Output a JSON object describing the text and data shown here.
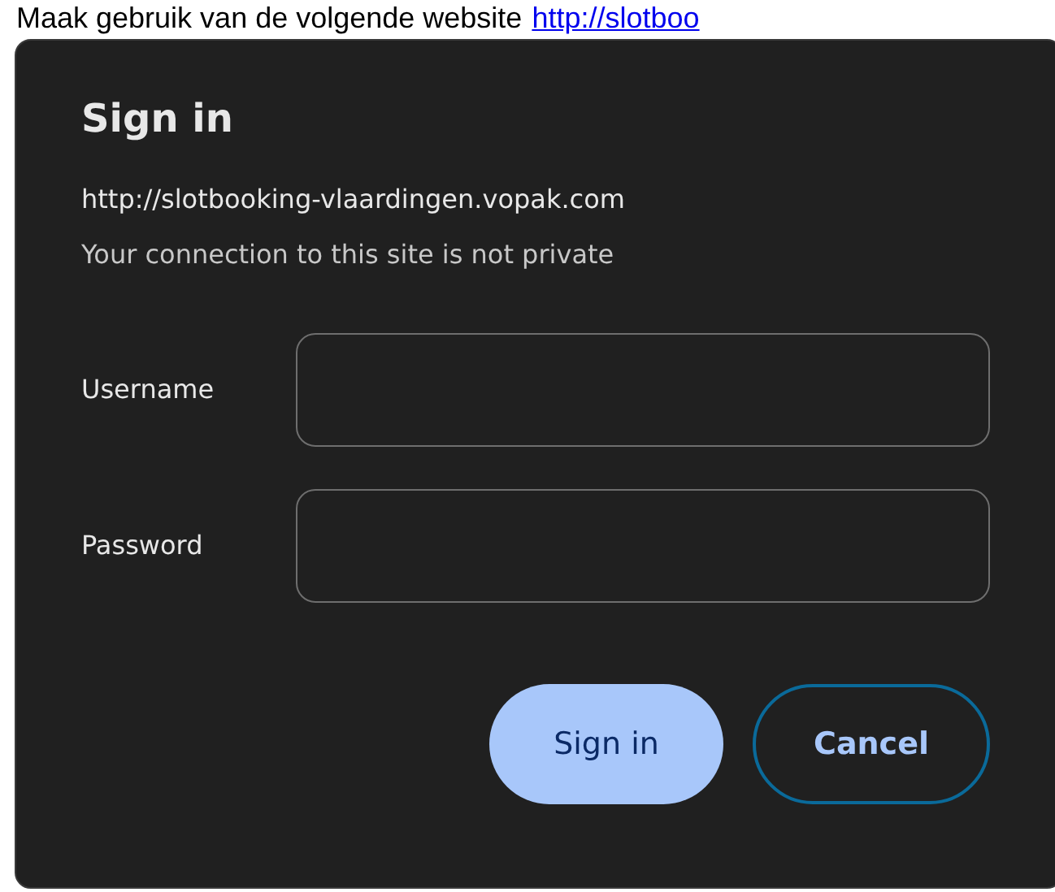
{
  "background_text": {
    "text": "Maak gebruik van de volgende website",
    "link": "http://slotboo"
  },
  "dialog": {
    "title": "Sign in",
    "url": "http://slotbooking-vlaardingen.vopak.com",
    "message": "Your connection to this site is not private",
    "fields": [
      {
        "label": "Username"
      },
      {
        "label": "Password"
      }
    ],
    "buttons": [
      {
        "label": "Sign in",
        "kind": "primary"
      },
      {
        "label": "Cancel",
        "kind": "secondary"
      }
    ]
  }
}
